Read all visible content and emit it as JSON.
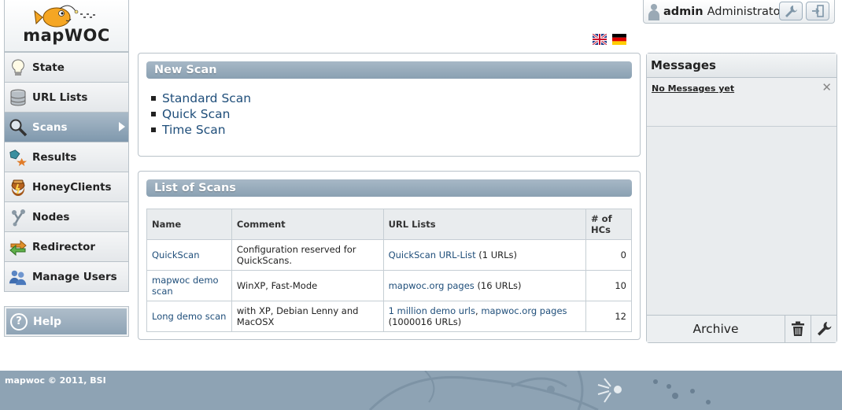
{
  "app": {
    "logo_text": "mapWOC"
  },
  "sidebar": {
    "items": [
      {
        "label": "State",
        "icon": "lightbulb-icon",
        "active": false
      },
      {
        "label": "URL Lists",
        "icon": "database-icon",
        "active": false
      },
      {
        "label": "Scans",
        "icon": "magnifier-icon",
        "active": true
      },
      {
        "label": "Results",
        "icon": "results-icon",
        "active": false
      },
      {
        "label": "HoneyClients",
        "icon": "honeypot-icon",
        "active": false
      },
      {
        "label": "Nodes",
        "icon": "nodes-icon",
        "active": false
      },
      {
        "label": "Redirector",
        "icon": "redirect-arrows-icon",
        "active": false
      },
      {
        "label": "Manage Users",
        "icon": "users-icon",
        "active": false
      }
    ],
    "help_label": "Help"
  },
  "user": {
    "name": "admin",
    "role": "Administrator"
  },
  "languages": [
    "en",
    "de"
  ],
  "new_scan": {
    "title": "New Scan",
    "links": [
      "Standard Scan",
      "Quick Scan",
      "Time Scan"
    ]
  },
  "scan_list": {
    "title": "List of Scans",
    "headers": {
      "name": "Name",
      "comment": "Comment",
      "url_lists": "URL Lists",
      "hcs_line1": "# of",
      "hcs_line2": "HCs"
    },
    "rows": [
      {
        "name": "QuickScan",
        "comment": "Configuration reserved for QuickScans.",
        "url_list_links": [
          "QuickScan URL-List"
        ],
        "url_count": "(1 URLs)",
        "hcs": "0"
      },
      {
        "name": "mapwoc demo scan",
        "comment": "WinXP, Fast-Mode",
        "url_list_links": [
          "mapwoc.org pages"
        ],
        "url_count": "(16 URLs)",
        "hcs": "10"
      },
      {
        "name": "Long demo scan",
        "comment": "with XP, Debian Lenny and MacOSX",
        "url_list_links": [
          "1 million demo urls",
          "mapwoc.org pages"
        ],
        "url_count": "(1000016 URLs)",
        "hcs": "12"
      }
    ]
  },
  "messages": {
    "title": "Messages",
    "items": [
      {
        "text": "No Messages yet"
      }
    ],
    "archive_label": "Archive"
  },
  "footer": {
    "copyright": "mapwoc © 2011, BSI"
  },
  "colors": {
    "accent": "#8aa0b2",
    "link": "#1f4e7a",
    "footer": "#8ea3b4"
  }
}
